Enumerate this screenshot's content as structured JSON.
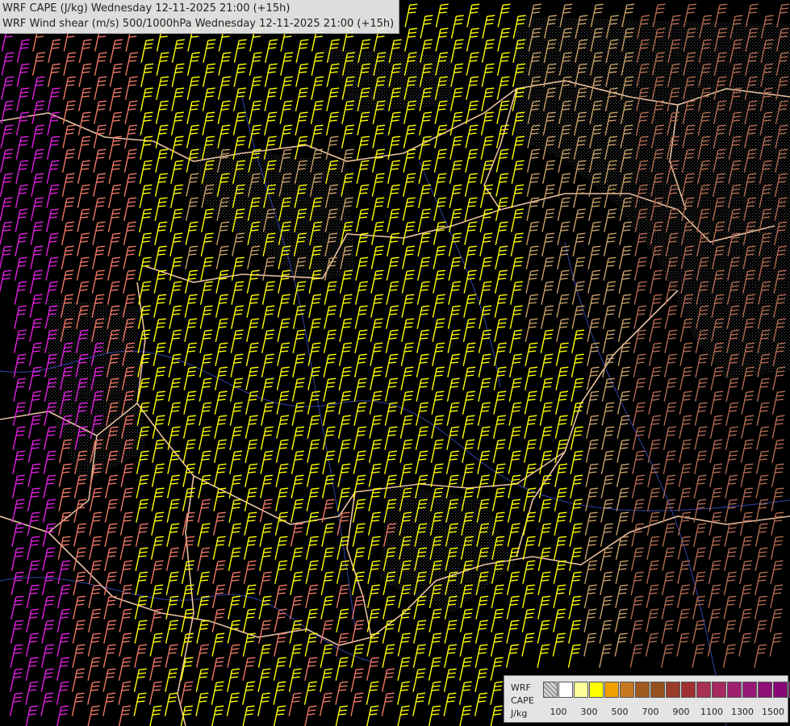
{
  "titles": {
    "line1": "WRF CAPE (J/kg) Wednesday 12-11-2025 21:00 (+15h)",
    "line2": "WRF Wind shear (m/s) 500/1000hPa Wednesday 12-11-2025 21:00 (+15h)"
  },
  "legend": {
    "model": "WRF",
    "field": "CAPE",
    "unit": "J/kg",
    "colors": [
      "#bbbbbb",
      "#ffffff",
      "#ffff99",
      "#ffff00",
      "#f0a000",
      "#c87820",
      "#a05a1e",
      "#965020",
      "#9a3c28",
      "#a03030",
      "#a83050",
      "#a82860",
      "#a02070",
      "#981878",
      "#901078",
      "#880878",
      "#800070"
    ],
    "tick_labels": [
      "100",
      "300",
      "500",
      "700",
      "900",
      "1100",
      "1300",
      "1500"
    ]
  },
  "wind_colors": {
    "yellow": "#ffff00",
    "tan": "#c8a068",
    "salmon": "#ee7766",
    "brown": "#b06a50",
    "magenta": "#e020e0",
    "border": "#e8c0a0",
    "river": "#3344aa",
    "cloud": "#bbbbbb"
  }
}
